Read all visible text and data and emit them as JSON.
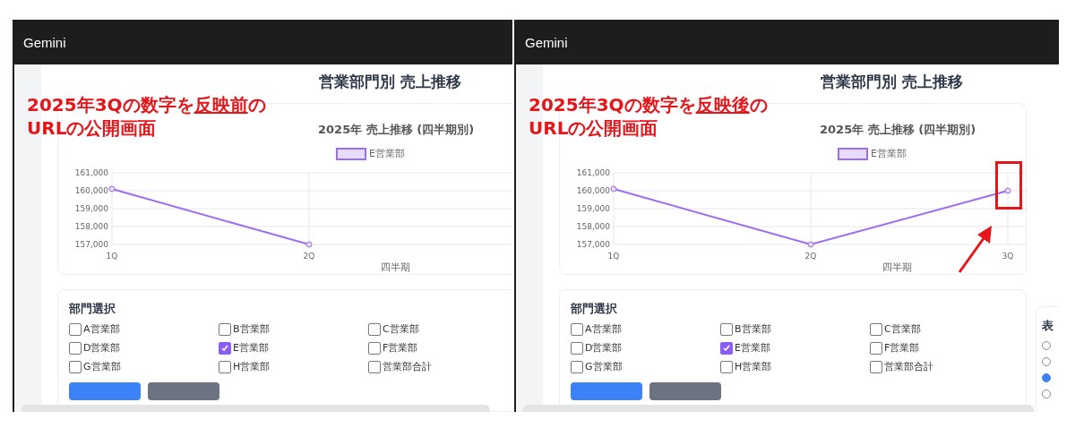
{
  "panels": [
    {
      "app_title": "Gemini",
      "page_title": "営業部門別 売上推移",
      "annotation": {
        "before": "2025年3Qの数字を",
        "underlined": "反映前",
        "after": "の",
        "line2": "URLの公開画面",
        "callout": false
      },
      "chart_data": {
        "type": "line",
        "title": "2025年 売上推移 (四半期別)",
        "xlabel": "四半期",
        "categories": [
          "1Q",
          "2Q"
        ],
        "ylim": [
          157000,
          161000
        ],
        "grid": true,
        "yticks": [
          {
            "value": 161000,
            "label": "161,000"
          },
          {
            "value": 160000,
            "label": "160,000"
          },
          {
            "value": 159000,
            "label": "159,000"
          },
          {
            "value": 158000,
            "label": "158,000"
          },
          {
            "value": 157000,
            "label": "157,000"
          }
        ],
        "series": [
          {
            "name": "E営業部",
            "color": "#9f6bf0",
            "marker": "circle",
            "values": [
              160100,
              157000
            ]
          }
        ]
      },
      "section_title": "部門選択",
      "departments": [
        {
          "label": "A営業部",
          "checked": false
        },
        {
          "label": "B営業部",
          "checked": false
        },
        {
          "label": "C営業部",
          "checked": false
        },
        {
          "label": "D営業部",
          "checked": false
        },
        {
          "label": "E営業部",
          "checked": true
        },
        {
          "label": "F営業部",
          "checked": false
        },
        {
          "label": "G営業部",
          "checked": false
        },
        {
          "label": "H営業部",
          "checked": false
        },
        {
          "label": "営業部合計",
          "checked": false
        }
      ]
    },
    {
      "app_title": "Gemini",
      "page_title": "営業部門別 売上推移",
      "annotation": {
        "before": "2025年3Qの数字を",
        "underlined": "反映後",
        "after": "の",
        "line2": "URLの公開画面",
        "callout": true
      },
      "chart_data": {
        "type": "line",
        "title": "2025年 売上推移 (四半期別)",
        "xlabel": "四半期",
        "categories": [
          "1Q",
          "2Q",
          "3Q"
        ],
        "ylim": [
          157000,
          161000
        ],
        "grid": true,
        "yticks": [
          {
            "value": 161000,
            "label": "161,000"
          },
          {
            "value": 160000,
            "label": "160,000"
          },
          {
            "value": 159000,
            "label": "159,000"
          },
          {
            "value": 158000,
            "label": "158,000"
          },
          {
            "value": 157000,
            "label": "157,000"
          }
        ],
        "series": [
          {
            "name": "E営業部",
            "color": "#9f6bf0",
            "marker": "circle",
            "values": [
              160100,
              157000,
              160000
            ]
          }
        ]
      },
      "section_title": "部門選択",
      "departments": [
        {
          "label": "A営業部",
          "checked": false
        },
        {
          "label": "B営業部",
          "checked": false
        },
        {
          "label": "C営業部",
          "checked": false
        },
        {
          "label": "D営業部",
          "checked": false
        },
        {
          "label": "E営業部",
          "checked": true
        },
        {
          "label": "F営業部",
          "checked": false
        },
        {
          "label": "G営業部",
          "checked": false
        },
        {
          "label": "H営業部",
          "checked": false
        },
        {
          "label": "営業部合計",
          "checked": false
        }
      ],
      "side_card": {
        "heading": "表",
        "radios": [
          {
            "selected": false
          },
          {
            "selected": false
          },
          {
            "selected": true
          },
          {
            "selected": false
          }
        ]
      }
    }
  ]
}
